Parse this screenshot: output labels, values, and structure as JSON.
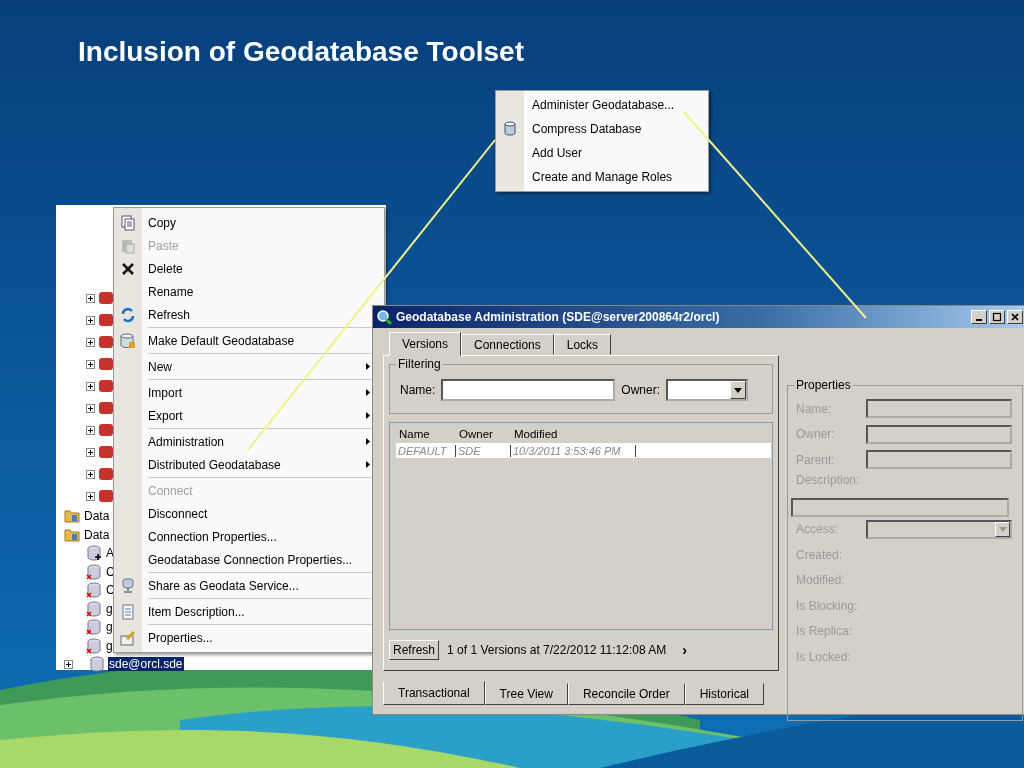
{
  "slide": {
    "title": "Inclusion of Geodatabase Toolset"
  },
  "catalog_tree": {
    "items": [
      {
        "kind": "dataset"
      },
      {
        "kind": "dataset"
      },
      {
        "kind": "dataset"
      },
      {
        "kind": "dataset"
      },
      {
        "kind": "dataset"
      },
      {
        "kind": "dataset"
      },
      {
        "kind": "dataset"
      },
      {
        "kind": "dataset"
      },
      {
        "kind": "dataset"
      },
      {
        "kind": "dataset"
      },
      {
        "kind": "folder",
        "label": "Data",
        "selected": false
      },
      {
        "kind": "folder",
        "label": "Data",
        "selected": false
      },
      {
        "kind": "add-connection",
        "label": "A",
        "selected": false
      },
      {
        "kind": "connection",
        "label": "C",
        "selected": false
      },
      {
        "kind": "connection",
        "label": "C",
        "selected": false
      },
      {
        "kind": "connection",
        "label": "g",
        "selected": false
      },
      {
        "kind": "connection",
        "label": "g",
        "selected": false
      },
      {
        "kind": "connection",
        "label": "g",
        "selected": false
      },
      {
        "kind": "geodatabase",
        "label": "sde@orcl.sde",
        "selected": true
      }
    ]
  },
  "context_menu": {
    "items": [
      {
        "label": "Copy",
        "kind": "copy",
        "disabled": false,
        "submenu": false,
        "separator_before": false
      },
      {
        "label": "Paste",
        "kind": "paste",
        "disabled": true,
        "submenu": false,
        "separator_before": false
      },
      {
        "label": "Delete",
        "kind": "delete",
        "disabled": false,
        "submenu": false,
        "separator_before": false
      },
      {
        "label": "Rename",
        "kind": "plain",
        "disabled": false,
        "submenu": false,
        "separator_before": false
      },
      {
        "label": "Refresh",
        "kind": "refresh",
        "disabled": false,
        "submenu": false,
        "separator_before": false
      },
      {
        "label": "Make Default Geodatabase",
        "kind": "database-lock",
        "disabled": false,
        "submenu": false,
        "separator_before": true
      },
      {
        "label": "New",
        "kind": "plain",
        "disabled": false,
        "submenu": true,
        "separator_before": true
      },
      {
        "label": "Import",
        "kind": "plain",
        "disabled": false,
        "submenu": true,
        "separator_before": true
      },
      {
        "label": "Export",
        "kind": "plain",
        "disabled": false,
        "submenu": true,
        "separator_before": false
      },
      {
        "label": "Administration",
        "kind": "plain",
        "disabled": false,
        "submenu": true,
        "separator_before": true
      },
      {
        "label": "Distributed Geodatabase",
        "kind": "plain",
        "disabled": false,
        "submenu": true,
        "separator_before": false
      },
      {
        "label": "Connect",
        "kind": "plain",
        "disabled": true,
        "submenu": false,
        "separator_before": true
      },
      {
        "label": "Disconnect",
        "kind": "plain",
        "disabled": false,
        "submenu": false,
        "separator_before": false
      },
      {
        "label": "Connection Properties...",
        "kind": "plain",
        "disabled": false,
        "submenu": false,
        "separator_before": false
      },
      {
        "label": "Geodatabase Connection Properties...",
        "kind": "plain",
        "disabled": false,
        "submenu": false,
        "separator_before": false
      },
      {
        "label": "Share as Geodata Service...",
        "kind": "server",
        "disabled": false,
        "submenu": false,
        "separator_before": true
      },
      {
        "label": "Item Description...",
        "kind": "document",
        "disabled": false,
        "submenu": false,
        "separator_before": true
      },
      {
        "label": "Properties...",
        "kind": "properties",
        "disabled": false,
        "submenu": false,
        "separator_before": true
      }
    ]
  },
  "admin_submenu": {
    "items": [
      {
        "label": "Administer Geodatabase...",
        "kind": "plain"
      },
      {
        "label": "Compress Database",
        "kind": "database"
      },
      {
        "label": "Add User",
        "kind": "plain"
      },
      {
        "label": "Create and Manage Roles",
        "kind": "plain"
      }
    ]
  },
  "dialog": {
    "title": "Geodatabase Administration (SDE@server200864r2/orcl)",
    "tabs": [
      {
        "label": "Versions",
        "selected": true
      },
      {
        "label": "Connections",
        "selected": false
      },
      {
        "label": "Locks",
        "selected": false
      }
    ],
    "filtering": {
      "title": "Filtering",
      "name_label": "Name:",
      "owner_label": "Owner:"
    },
    "versions": {
      "columns": [
        "Name",
        "Owner",
        "Modified"
      ],
      "rows": [
        {
          "cells": [
            "DEFAULT",
            "SDE",
            "10/3/2011 3:53:46 PM"
          ]
        }
      ]
    },
    "refresh_button": "Refresh",
    "status": "1 of 1 Versions at 7/22/2012 11:12:08 AM",
    "next": "›",
    "bottom_tabs": [
      {
        "label": "Transactional",
        "selected": true
      },
      {
        "label": "Tree View",
        "selected": false
      },
      {
        "label": "Reconcile Order",
        "selected": false
      },
      {
        "label": "Historical",
        "selected": false
      }
    ],
    "properties": {
      "title": "Properties",
      "fields": [
        {
          "label": "Name:",
          "kind": "text",
          "disabled": true
        },
        {
          "label": "Owner:",
          "kind": "text",
          "disabled": true
        },
        {
          "label": "Parent:",
          "kind": "text",
          "disabled": true
        },
        {
          "label": "Description:",
          "kind": "wide",
          "disabled": true
        },
        {
          "label": "Access:",
          "kind": "combo",
          "disabled": true
        },
        {
          "label": "Created:",
          "kind": "label",
          "disabled": true
        },
        {
          "label": "Modified:",
          "kind": "label",
          "disabled": true
        },
        {
          "label": "Is Blocking:",
          "kind": "label",
          "disabled": true
        },
        {
          "label": "Is Replica:",
          "kind": "label",
          "disabled": true
        },
        {
          "label": "Is Locked:",
          "kind": "label",
          "disabled": true
        }
      ]
    }
  }
}
